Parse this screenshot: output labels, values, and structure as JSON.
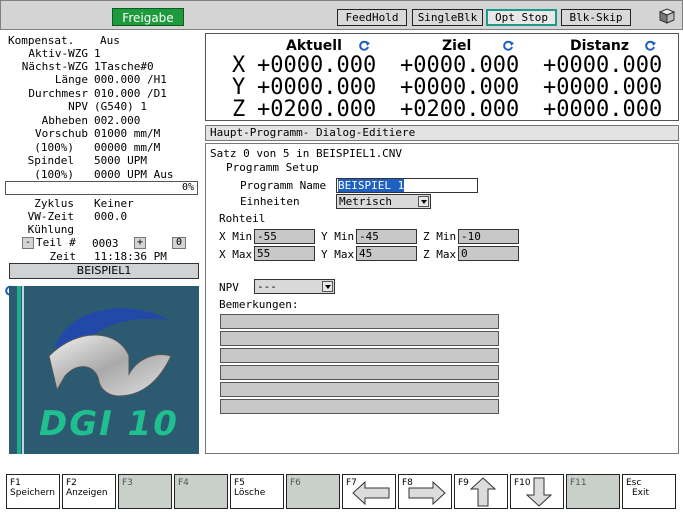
{
  "toolbar": {
    "freigabe": "Freigabe",
    "buttons": [
      {
        "label": "FeedHold",
        "active": false
      },
      {
        "label": "SingleBlk",
        "active": false
      },
      {
        "label": "Opt Stop",
        "active": true
      },
      {
        "label": "Blk-Skip",
        "active": false
      }
    ],
    "app_icon": "app-cube-icon"
  },
  "status": {
    "rows": [
      {
        "label": "Kompensat.",
        "value": "Aus"
      },
      {
        "label": "Aktiv-WZG",
        "value": "1"
      },
      {
        "label": "Nächst-WZG",
        "value": "1Tasche#0"
      },
      {
        "label": "Länge",
        "value": "000.000 /H1"
      },
      {
        "label": "Durchmesr",
        "value": "010.000 /D1"
      },
      {
        "label": "NPV",
        "value": "(G540) 1"
      },
      {
        "label": "Abheben",
        "value": "002.000"
      },
      {
        "label": "Vorschub",
        "value": "01000 mm/M"
      },
      {
        "label": "(100%)",
        "value": "00000 mm/M"
      },
      {
        "label": "Spindel",
        "value": "5000 UPM"
      },
      {
        "label": "(100%)",
        "value": "0000 UPM Aus"
      }
    ],
    "progress_text": "0%",
    "progress": 0,
    "rows2": [
      {
        "label": "Zyklus",
        "value": "Keiner"
      },
      {
        "label": "VW-Zeit",
        "value": "000.0"
      },
      {
        "label": "Kühlung",
        "value": ""
      }
    ],
    "teil_minus": "-",
    "teil_label": "Teil #",
    "teil_value": "0003",
    "teil_plus": "+",
    "teil_count": "0",
    "zeit_label": "Zeit",
    "zeit_value": "11:18:36 PM",
    "program_name": "BEISPIEL1",
    "logo_text": "DGI 10"
  },
  "dro": {
    "headers": [
      "Aktuell",
      "Ziel",
      "Distanz"
    ],
    "axes": [
      {
        "axis": "X",
        "aktuell": "+0000.000",
        "ziel": "+0000.000",
        "distanz": "+0000.000"
      },
      {
        "axis": "Y",
        "aktuell": "+0000.000",
        "ziel": "+0000.000",
        "distanz": "+0000.000"
      },
      {
        "axis": "Z",
        "aktuell": "+0200.000",
        "ziel": "+0200.000",
        "distanz": "+0000.000"
      }
    ]
  },
  "editor": {
    "title": "Haupt-Programm-  Dialog-Editiere",
    "satz": "Satz 0 von 5 in BEISPIEL1.CNV",
    "setup": "Programm Setup",
    "programm_name_label": "Programm Name",
    "programm_name_value": "BEISPIEL 1",
    "einheiten_label": "Einheiten",
    "einheiten_value": "Metrisch",
    "rohteil_label": "Rohteil",
    "xmin_label": "X Min",
    "xmin": "-55",
    "ymin_label": "Y Min",
    "ymin": "-45",
    "zmin_label": "Z Min",
    "zmin": "-10",
    "xmax_label": "X Max",
    "xmax": "55",
    "ymax_label": "Y Max",
    "ymax": "45",
    "zmax_label": "Z Max",
    "zmax": "0",
    "npv_label": "NPV",
    "npv_value": "---",
    "bemerkungen_label": "Bemerkungen:",
    "remarks": [
      "",
      "",
      "",
      "",
      "",
      ""
    ]
  },
  "fkeys": [
    {
      "key": "F1",
      "label": "Speichern",
      "enabled": true
    },
    {
      "key": "F2",
      "label": "Anzeigen",
      "enabled": true
    },
    {
      "key": "F3",
      "label": "",
      "enabled": false
    },
    {
      "key": "F4",
      "label": "",
      "enabled": false
    },
    {
      "key": "F5",
      "label": "Lösche",
      "enabled": true
    },
    {
      "key": "F6",
      "label": "",
      "enabled": false
    },
    {
      "key": "F7",
      "label": "",
      "enabled": true,
      "icon": "arrow-left-icon"
    },
    {
      "key": "F8",
      "label": "",
      "enabled": true,
      "icon": "arrow-right-icon"
    },
    {
      "key": "F9",
      "label": "",
      "enabled": true,
      "icon": "arrow-up-icon"
    },
    {
      "key": "F10",
      "label": "",
      "enabled": true,
      "icon": "arrow-down-icon"
    },
    {
      "key": "F11",
      "label": "",
      "enabled": false
    },
    {
      "key": "Esc",
      "label": "Exit",
      "enabled": true
    }
  ]
}
